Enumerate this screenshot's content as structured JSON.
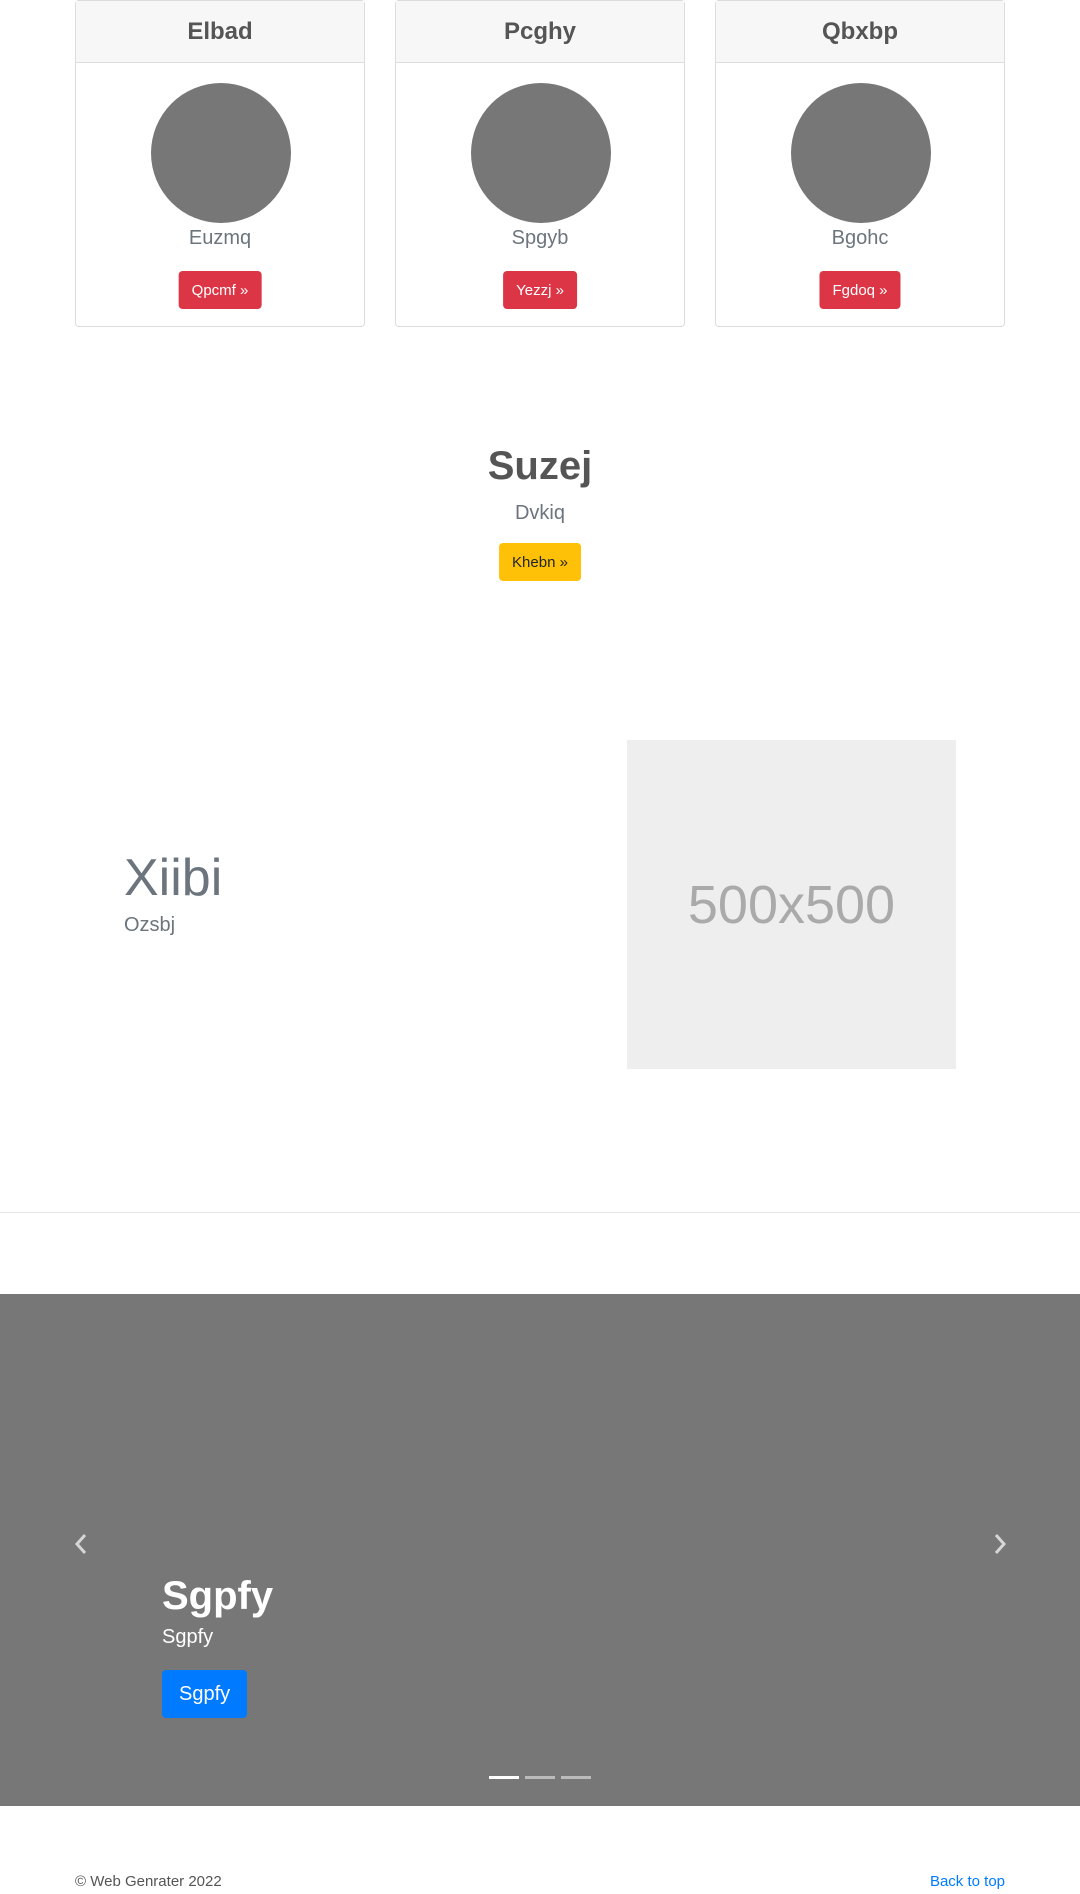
{
  "cards": [
    {
      "header": "Elbad",
      "subtitle": "Euzmq",
      "button": "Qpcmf »"
    },
    {
      "header": "Pcghy",
      "subtitle": "Spgyb",
      "button": "Yezzj »"
    },
    {
      "header": "Qbxbp",
      "subtitle": "Bgohc",
      "button": "Fgdoq »"
    }
  ],
  "center": {
    "title": "Suzej",
    "subtitle": "Dvkiq",
    "button": "Khebn »"
  },
  "feature": {
    "title": "Xiibi",
    "subtitle": "Ozsbj",
    "placeholder": "500x500"
  },
  "carousel": {
    "title": "Sgpfy",
    "subtitle": "Sgpfy",
    "button": "Sgpfy",
    "prev_icon": "chevron-left-icon",
    "next_icon": "chevron-right-icon",
    "slide_count": 3,
    "active_slide": 0
  },
  "footer": {
    "copyright": "© Web Genrater 2022",
    "back_to_top": "Back to top"
  },
  "colors": {
    "danger": "#dc3545",
    "warning": "#ffc107",
    "primary": "#007bff",
    "carousel_bg": "#777777"
  }
}
